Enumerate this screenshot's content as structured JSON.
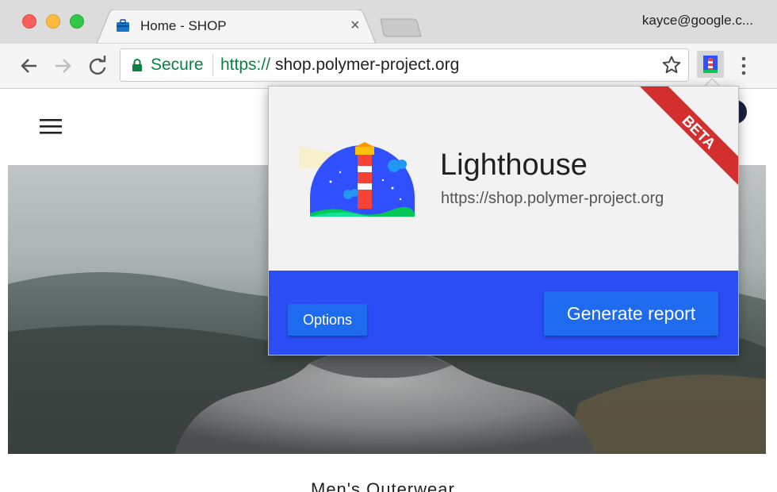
{
  "browser": {
    "tab": {
      "title": "Home - SHOP",
      "close_glyph": "×",
      "favicon": "briefcase-icon"
    },
    "profile": "kayce@google.c...",
    "omnibox": {
      "security_label": "Secure",
      "url_scheme": "https://",
      "url_host": "shop.polymer-project.org"
    },
    "icons": [
      "back-arrow-icon",
      "forward-arrow-icon",
      "reload-icon",
      "lock-icon",
      "star-icon",
      "lighthouse-extension-icon",
      "more-vert-icon"
    ]
  },
  "popup": {
    "title": "Lighthouse",
    "url": "https://shop.polymer-project.org",
    "ribbon": "BETA",
    "options_label": "Options",
    "generate_label": "Generate report",
    "colors": {
      "footer": "#2b4df5",
      "button": "#1f6bf0",
      "ribbon": "#d32f2f"
    }
  },
  "page": {
    "bottom_text": "Men's Outerwear"
  }
}
